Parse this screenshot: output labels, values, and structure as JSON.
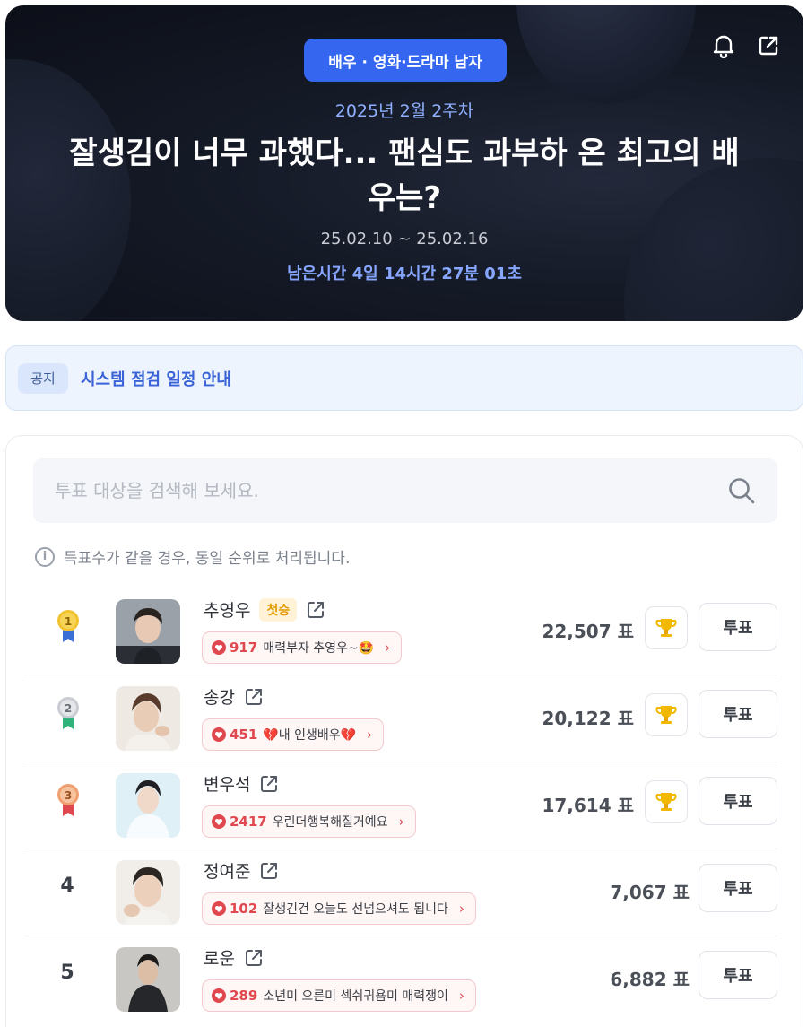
{
  "header": {
    "category": "배우 · 영화·드라마 남자",
    "week": "2025년 2월 2주차",
    "title": "잘생김이 너무 과했다... 팬심도 과부하 온 최고의 배우는?",
    "period": "25.02.10 ~ 25.02.16",
    "remaining": "남은시간 4일 14시간 27분 01초",
    "icons": [
      "bell-icon",
      "share-icon"
    ]
  },
  "notice": {
    "tag": "공지",
    "text": "시스템 점검 일정 안내"
  },
  "search": {
    "placeholder": "투표 대상을 검색해 보세요."
  },
  "info": {
    "text": "득표수가 같을 경우, 동일 순위로 처리됩니다.",
    "icon": "i"
  },
  "rankings": [
    {
      "rank": "1",
      "name": "추영우",
      "badge": "첫승",
      "cheer_count": "917",
      "cheer_message": "매력부자 추영우~🤩",
      "votes": "22,507 표",
      "vote_label": "투표",
      "medal_color": "#f2c230",
      "ribbon_color": "#3a6fd8"
    },
    {
      "rank": "2",
      "name": "송강",
      "badge": "",
      "cheer_count": "451",
      "cheer_message": "💔내 인생배우💔",
      "votes": "20,122 표",
      "vote_label": "투표",
      "medal_color": "#c9ccd2",
      "ribbon_color": "#2fb37a"
    },
    {
      "rank": "3",
      "name": "변우석",
      "badge": "",
      "cheer_count": "2417",
      "cheer_message": "우린더행복해질거예요",
      "votes": "17,614 표",
      "vote_label": "투표",
      "medal_color": "#f0a070",
      "ribbon_color": "#e0484f"
    },
    {
      "rank": "4",
      "name": "정여준",
      "badge": "",
      "cheer_count": "102",
      "cheer_message": "잘생긴건 오늘도 선넘으셔도 됩니다",
      "votes": "7,067 표",
      "vote_label": "투표"
    },
    {
      "rank": "5",
      "name": "로운",
      "badge": "",
      "cheer_count": "289",
      "cheer_message": "소년미 으른미 섹쉬귀욤미 매력쟁이",
      "votes": "6,882 표",
      "vote_label": "투표"
    }
  ],
  "colors": {
    "accent": "#3466f0",
    "heart": "#e0484f",
    "trophy": "#f2b800"
  }
}
